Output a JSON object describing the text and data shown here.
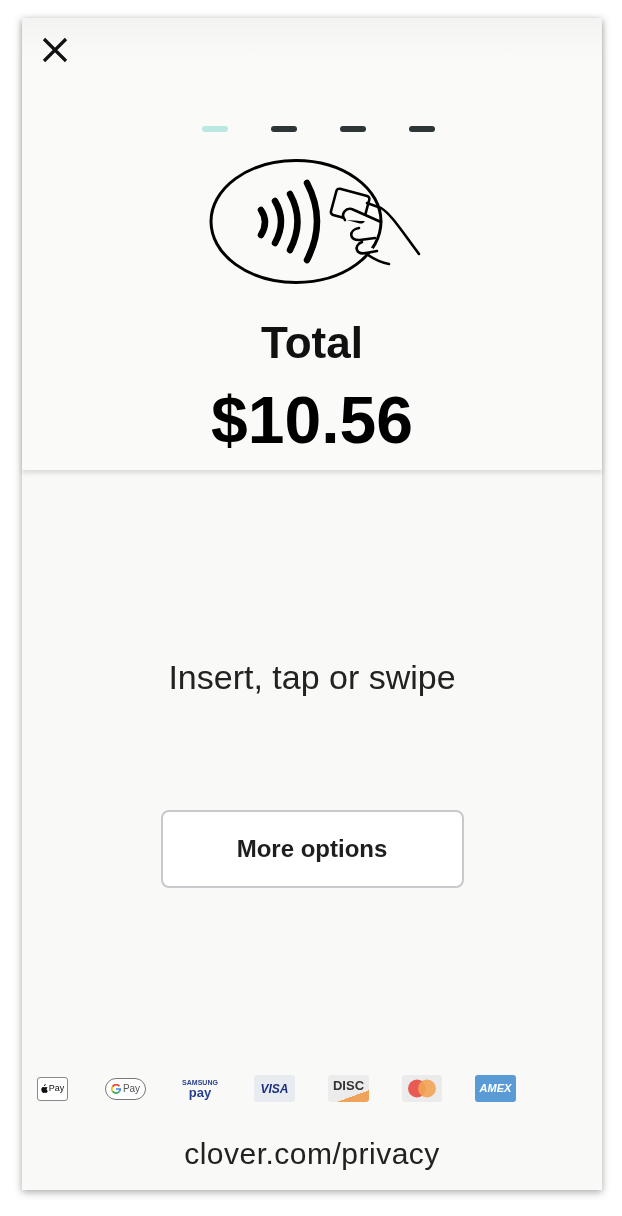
{
  "steps": [
    {
      "selected": true
    },
    {
      "selected": false
    },
    {
      "selected": false
    },
    {
      "selected": false
    }
  ],
  "total": {
    "label": "Total",
    "amount": "$10.56"
  },
  "prompt": "Insert, tap or swipe",
  "more_options_button": "More options",
  "payment_methods": [
    {
      "kind": "apple_pay",
      "label": "Pay"
    },
    {
      "kind": "google_pay",
      "label": "Pay"
    },
    {
      "kind": "samsung_pay",
      "brand": "SAMSUNG",
      "label": "pay"
    },
    {
      "kind": "visa",
      "label": "VISA"
    },
    {
      "kind": "discover",
      "label": "DISC"
    },
    {
      "kind": "mastercard"
    },
    {
      "kind": "amex",
      "label": "AMEX"
    }
  ],
  "footer_link": "clover.com/privacy"
}
